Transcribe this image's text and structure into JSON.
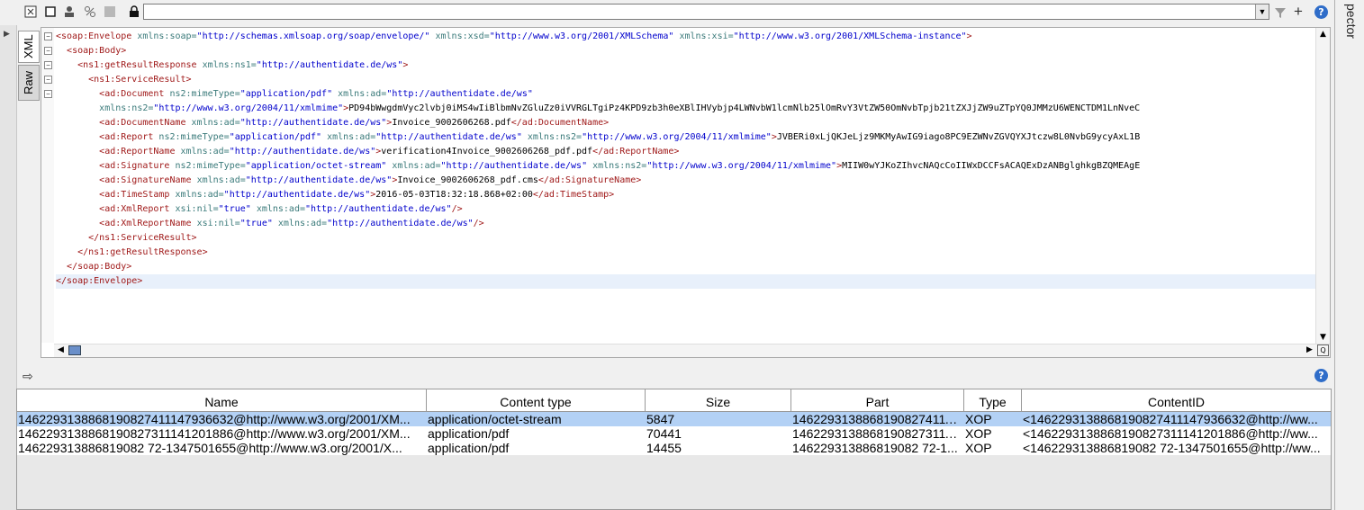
{
  "toolbar": {
    "icons": [
      "collapse-icon",
      "checkbox-icon",
      "cut-icon",
      "person-icon",
      "tools-icon",
      "gray-square-icon",
      "lock-icon"
    ],
    "xpath_value": "",
    "right_icons": [
      "dropdown-icon",
      "filter-icon",
      "plus-icon",
      "help-icon"
    ]
  },
  "side_tabs": {
    "xml": "XML",
    "raw": "Raw"
  },
  "right_panel": {
    "title": "pector"
  },
  "attachments": {
    "columns": [
      "Name",
      "Content type",
      "Size",
      "Part",
      "Type",
      "ContentID"
    ],
    "rows": [
      [
        "1462293138868190827411147936632@http://www.w3.org/2001/XM...",
        "application/octet-stream",
        "5847",
        "146229313886819082741114...",
        "XOP",
        "<1462293138868190827411147936632@http://ww..."
      ],
      [
        "1462293138868190827311141201886@http://www.w3.org/2001/XM...",
        "application/pdf",
        "70441",
        "146229313886819082731114...",
        "XOP",
        "<1462293138868190827311141201886@http://ww..."
      ],
      [
        "146229313886819082 72-1347501655@http://www.w3.org/2001/X...",
        "application/pdf",
        "14455",
        "146229313886819082 72-1...",
        "XOP",
        "<146229313886819082 72-1347501655@http://ww..."
      ]
    ]
  }
}
